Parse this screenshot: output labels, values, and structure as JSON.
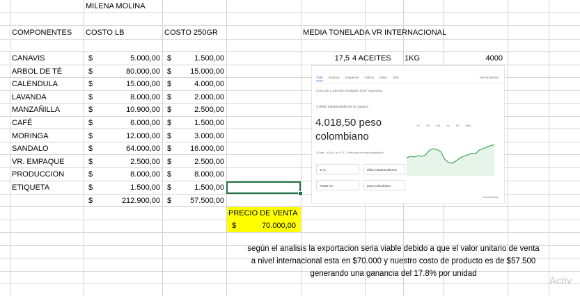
{
  "title": "MILENA MOLINA",
  "headers": {
    "componentes": "COMPONENTES",
    "costo_lb": "COSTO LB",
    "costo_250": "COSTO 250GR",
    "media": "MEDIA TONELADA VR INTERNACIONAL"
  },
  "side_info": {
    "v1": "17,5",
    "v2": "4 ACEITES",
    "v3": "1KG",
    "v4": "4000"
  },
  "rows": [
    {
      "name": "CANAVIS",
      "cur1": "$",
      "lb": "5.000,00",
      "cur2": "$",
      "gr": "1.500,00"
    },
    {
      "name": "ARBOL DE TÉ",
      "cur1": "$",
      "lb": "80.000,00",
      "cur2": "$",
      "gr": "15.000,00"
    },
    {
      "name": "CALENDULA",
      "cur1": "$",
      "lb": "15.000,00",
      "cur2": "$",
      "gr": "4.000,00"
    },
    {
      "name": "LAVANDA",
      "cur1": "$",
      "lb": "8.000,00",
      "cur2": "$",
      "gr": "2.000,00"
    },
    {
      "name": "MANZAÑILLA",
      "cur1": "$",
      "lb": "10.900,00",
      "cur2": "$",
      "gr": "2.500,00"
    },
    {
      "name": "CAFÉ",
      "cur1": "$",
      "lb": "6.000,00",
      "cur2": "$",
      "gr": "1.500,00"
    },
    {
      "name": "MORINGA",
      "cur1": "$",
      "lb": "12.000,00",
      "cur2": "$",
      "gr": "3.000,00"
    },
    {
      "name": "SANDALO",
      "cur1": "$",
      "lb": "64.000,00",
      "cur2": "$",
      "gr": "16.000,00"
    },
    {
      "name": "VR. EMPAQUE",
      "cur1": "$",
      "lb": "2.500,00",
      "cur2": "$",
      "gr": "2.500,00"
    },
    {
      "name": "PRODUCCION",
      "cur1": "$",
      "lb": "8.000,00",
      "cur2": "$",
      "gr": "8.000,00"
    },
    {
      "name": "ETIQUETA",
      "cur1": "$",
      "lb": "1.500,00",
      "cur2": "$",
      "gr": "1.500,00"
    }
  ],
  "totals": {
    "cur1": "$",
    "lb": "212.900,00",
    "cur2": "$",
    "gr": "57.500,00"
  },
  "precio": {
    "label": "PRECIO DE VENTA",
    "cur": "$",
    "value": "70.000,00"
  },
  "note": {
    "line1": "según el analisis la exportacion seria viable debido a que el valor unitario de venta",
    "line2": "a nivel internacional esta en $70.000 y nuestro costo de producto es de $57.500",
    "line3": "generando una ganancia del 17.8% por unidad"
  },
  "embedded_search": {
    "tabs": [
      "Todo",
      "Noticias",
      "Imágenes",
      "Videos",
      "Maps",
      "Más"
    ],
    "tools": "Herramientas",
    "results": "Cerca de 2.230.000 resultados (0,47 segundos)",
    "question": "1 dólar estadounidense es igual a",
    "big_value": "4.018,50 peso colombiano",
    "small": "23 abr., 9:30 p. m. UTC · Renuncia de responsabilidad",
    "input1_value": "17,5",
    "input1_unit": "dólar estadounidense",
    "input2_value": "70322,75",
    "input2_unit": "peso colombiano",
    "ranges": [
      "1D",
      "5D",
      "1M",
      "1A",
      "5A",
      "Máx."
    ],
    "footer": "Comentarios",
    "chart_points": [
      0.55,
      0.5,
      0.52,
      0.48,
      0.5,
      0.45,
      0.3,
      0.25,
      0.28,
      0.35,
      0.6,
      0.7,
      0.72,
      0.65,
      0.55,
      0.5,
      0.45,
      0.4,
      0.42,
      0.3,
      0.25,
      0.2,
      0.15,
      0.12
    ]
  },
  "watermark": "Activ"
}
